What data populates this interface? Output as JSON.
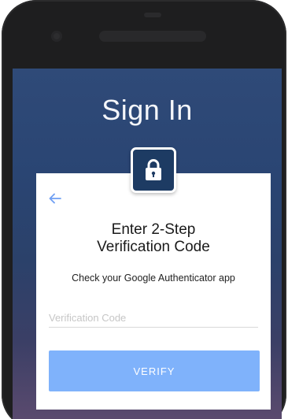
{
  "screen": {
    "title": "Sign In"
  },
  "card": {
    "heading_line1": "Enter 2-Step",
    "heading_line2": "Verification Code",
    "subtext": "Check your Google Authenticator app",
    "code_field": {
      "placeholder": "Verification Code",
      "value": ""
    },
    "verify_label": "VERIFY"
  },
  "icons": {
    "back": "back-arrow-icon",
    "lock": "lock-icon"
  },
  "colors": {
    "accent": "#7fb2fb",
    "back_arrow": "#6f9ff3",
    "lock_bg": "#1d3b63",
    "screen_bg_top": "#2f4a78",
    "screen_bg_bottom": "#5a4a6e"
  }
}
